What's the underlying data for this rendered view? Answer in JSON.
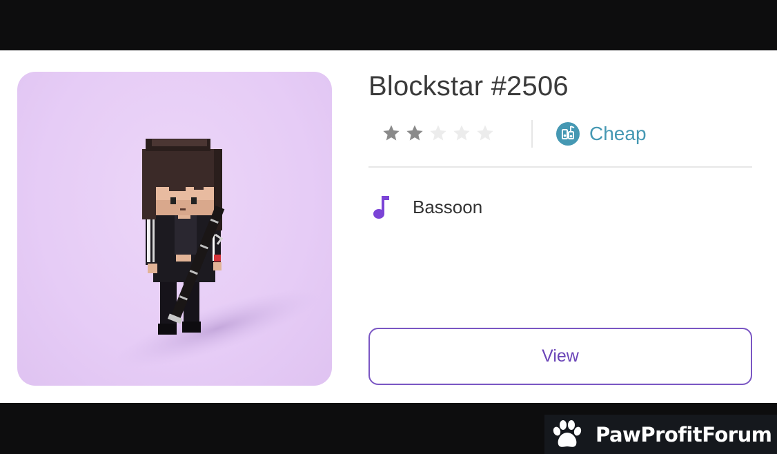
{
  "item": {
    "title": "Blockstar #2506",
    "rating": 2,
    "rating_max": 5,
    "tier_label": "Cheap",
    "tier_icon": "music-library-icon",
    "instrument_icon": "music-note-icon",
    "instrument": "Bassoon",
    "view_label": "View",
    "art_background": "#e6ccf6"
  },
  "watermark": {
    "icon": "paw-icon",
    "text": "PawProfitForum"
  },
  "colors": {
    "star_filled": "#8a8a8a",
    "star_empty": "#ececec",
    "tier": "#4598b3",
    "accent": "#7a56c3",
    "note": "#7b44d6"
  }
}
